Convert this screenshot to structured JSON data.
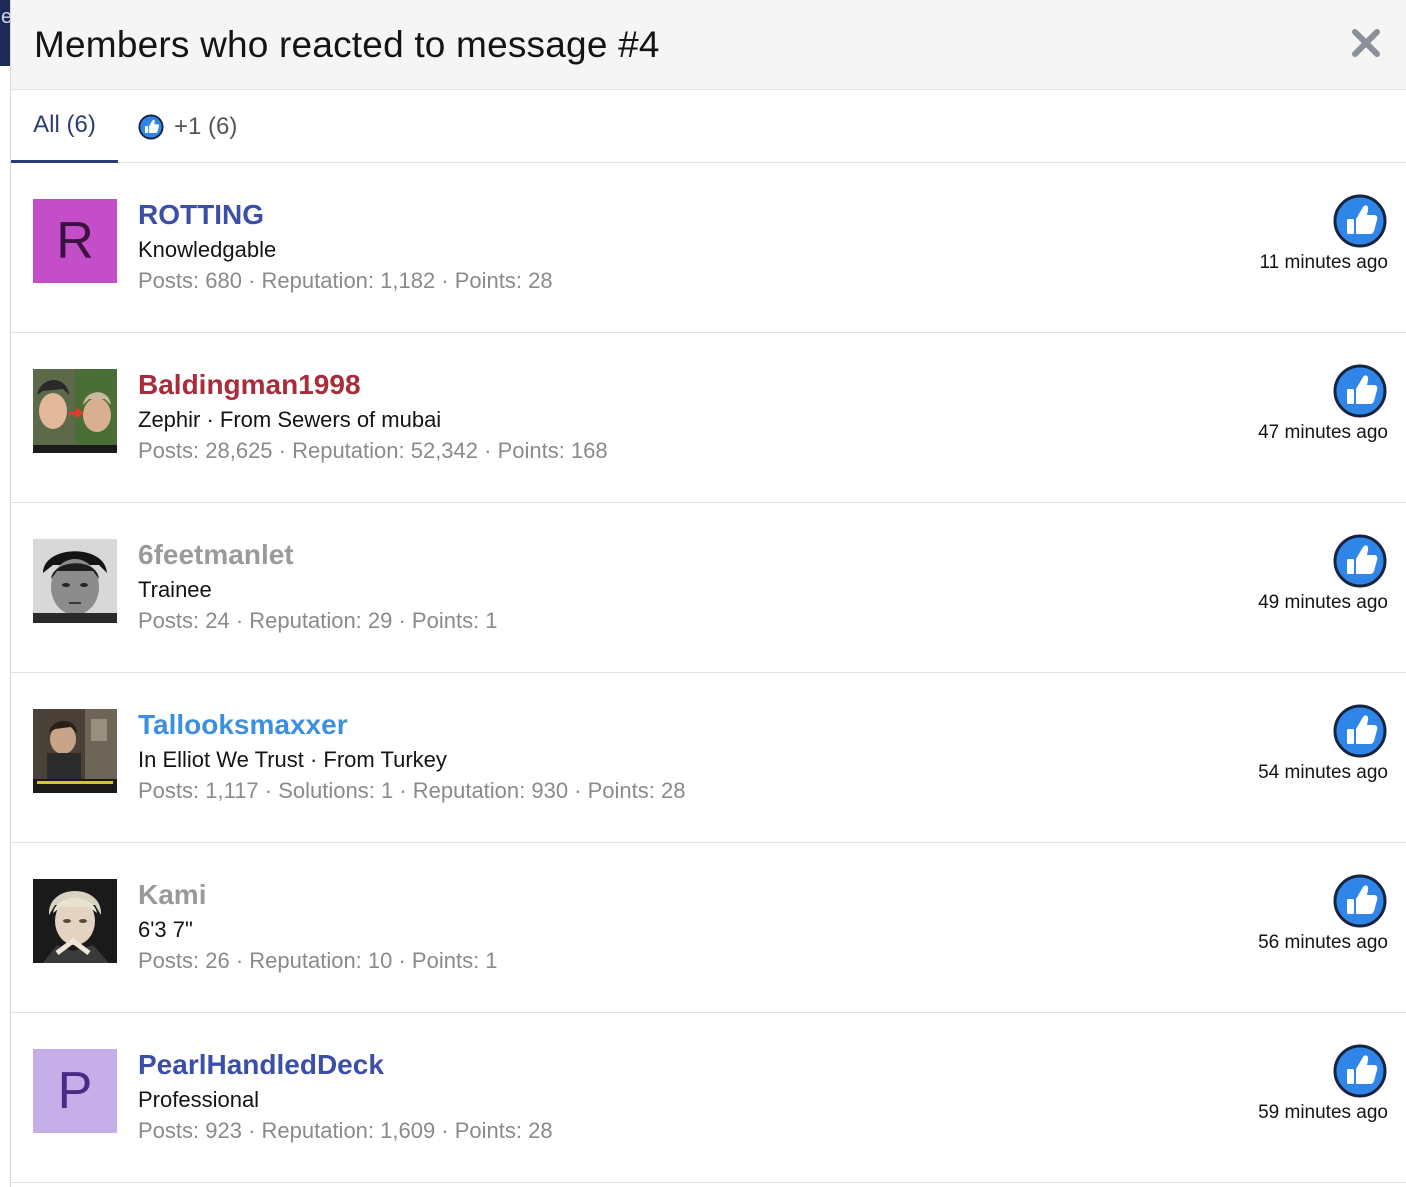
{
  "dialog": {
    "title": "Members who reacted to message #4",
    "close_icon": "close-icon"
  },
  "tabs": [
    {
      "label": "All (6)",
      "active": true
    },
    {
      "label": "+1 (6)",
      "icon": "thumbs-up-icon",
      "active": false
    }
  ],
  "colors": {
    "accent": "#2b3d73",
    "like_blue": "#2f86e8",
    "muted_text": "#8a8a8a",
    "name_blue": "#3b4fa8",
    "name_red": "#a82d3a",
    "name_grey": "#9a9a9a",
    "name_lightblue": "#3d8fe0"
  },
  "members": [
    {
      "username": "ROTTING",
      "title": "Knowledgable",
      "stats": "Posts: 680 · Reputation: 1,182 · Points: 28",
      "time": "11 minutes ago",
      "avatar_letter": "R",
      "avatar_bg": "#c44dc8",
      "avatar_fg": "#3b1240",
      "name_color": "#3b4fa8",
      "reaction_icon": "thumbs-up-icon"
    },
    {
      "username": "Baldingman1998",
      "title": "Zephir · From Sewers of mubai",
      "stats": "Posts: 28,625 · Reputation: 52,342 · Points: 168",
      "time": "47 minutes ago",
      "avatar_letter": "",
      "avatar_bg": "",
      "avatar_fg": "",
      "name_color": "#a82d3a",
      "reaction_icon": "thumbs-up-icon"
    },
    {
      "username": "6feetmanlet",
      "title": "Trainee",
      "stats": "Posts: 24 · Reputation: 29 · Points: 1",
      "time": "49 minutes ago",
      "avatar_letter": "",
      "avatar_bg": "",
      "avatar_fg": "",
      "name_color": "#9a9a9a",
      "reaction_icon": "thumbs-up-icon"
    },
    {
      "username": "Tallooksmaxxer",
      "title": "In Elliot We Trust · From Turkey",
      "stats": "Posts: 1,117 · Solutions: 1 · Reputation: 930 · Points: 28",
      "time": "54 minutes ago",
      "avatar_letter": "",
      "avatar_bg": "",
      "avatar_fg": "",
      "name_color": "#3d8fe0",
      "reaction_icon": "thumbs-up-icon"
    },
    {
      "username": "Kami",
      "title": "6'3 7\"",
      "stats": "Posts: 26 · Reputation: 10 · Points: 1",
      "time": "56 minutes ago",
      "avatar_letter": "",
      "avatar_bg": "",
      "avatar_fg": "",
      "name_color": "#9a9a9a",
      "reaction_icon": "thumbs-up-icon"
    },
    {
      "username": "PearlHandledDeck",
      "title": "Professional",
      "stats": "Posts: 923 · Reputation: 1,609 · Points: 28",
      "time": "59 minutes ago",
      "avatar_letter": "P",
      "avatar_bg": "#c6aee8",
      "avatar_fg": "#4b2a86",
      "name_color": "#3b4fa8",
      "reaction_icon": "thumbs-up-icon"
    }
  ]
}
